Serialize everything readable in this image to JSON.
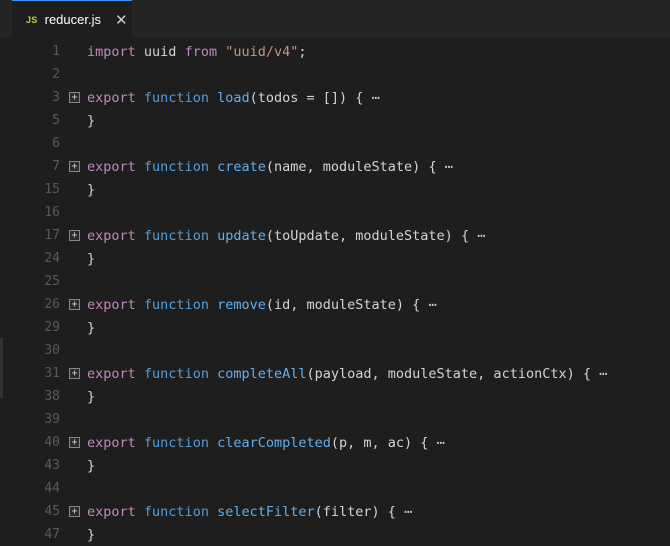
{
  "tab": {
    "icon": "JS",
    "filename": "reducer.js",
    "close": "✕"
  },
  "lines": [
    {
      "num": "1",
      "import_kw": "import",
      "import_name": "uuid",
      "from_kw": "from",
      "source": "\"uuid/v4\"",
      "semi": ";"
    },
    {
      "num": "2"
    },
    {
      "num": "3",
      "export": "export",
      "function": "function",
      "name": "load",
      "params": "(todos = [])",
      "open": " {",
      "ellipsis": "⋯"
    },
    {
      "num": "5",
      "close": "}"
    },
    {
      "num": "6"
    },
    {
      "num": "7",
      "export": "export",
      "function": "function",
      "name": "create",
      "params": "(name, moduleState)",
      "open": " {",
      "ellipsis": "⋯"
    },
    {
      "num": "15",
      "close": "}"
    },
    {
      "num": "16"
    },
    {
      "num": "17",
      "export": "export",
      "function": "function",
      "name": "update",
      "params": "(toUpdate, moduleState)",
      "open": " {",
      "ellipsis": "⋯"
    },
    {
      "num": "24",
      "close": "}"
    },
    {
      "num": "25"
    },
    {
      "num": "26",
      "export": "export",
      "function": "function",
      "name": "remove",
      "params": "(id, moduleState)",
      "open": " {",
      "ellipsis": "⋯"
    },
    {
      "num": "29",
      "close": "}"
    },
    {
      "num": "30"
    },
    {
      "num": "31",
      "export": "export",
      "function": "function",
      "name": "completeAll",
      "params": "(payload, moduleState, actionCtx)",
      "open": " {",
      "ellipsis": "⋯"
    },
    {
      "num": "38",
      "close": "}"
    },
    {
      "num": "39"
    },
    {
      "num": "40",
      "export": "export",
      "function": "function",
      "name": "clearCompleted",
      "params": "(p, m, ac)",
      "open": " {",
      "ellipsis": "⋯"
    },
    {
      "num": "43",
      "close": "}"
    },
    {
      "num": "44"
    },
    {
      "num": "45",
      "export": "export",
      "function": "function",
      "name": "selectFilter",
      "params": "(filter)",
      "open": " {",
      "ellipsis": "⋯"
    },
    {
      "num": "47",
      "close": "}"
    }
  ]
}
